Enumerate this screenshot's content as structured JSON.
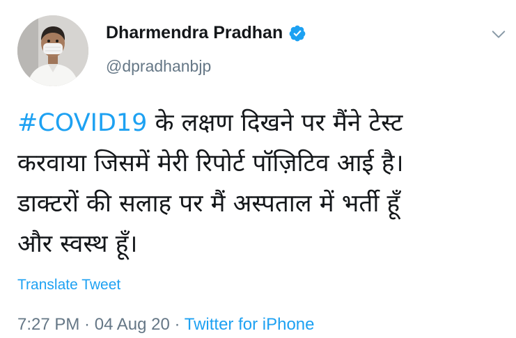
{
  "author": {
    "name": "Dharmendra Pradhan",
    "handle": "@dpradhanbjp",
    "verified": true,
    "avatar": "profile-photo-man-in-white-kurta-wearing-mask"
  },
  "tweet": {
    "hashtag": "#COVID19",
    "line1_rest": " के लक्षण दिखने पर मैंने टेस्ट",
    "line2": "करवाया जिसमें मेरी रिपोर्ट पॉज़िटिव आई है।",
    "line3": "डाक्टरों की सलाह पर मैं अस्पताल में भर्ती हूँ",
    "line4": "और स्वस्थ हूँ।"
  },
  "translate_label": "Translate Tweet",
  "meta": {
    "time": "7:27 PM",
    "separator1": " · ",
    "date": "04 Aug 20",
    "separator2": " · ",
    "source": "Twitter for iPhone"
  },
  "colors": {
    "accent": "#1da1f2",
    "text": "#14171a",
    "secondary": "#657786"
  },
  "icons": {
    "verified": "verified-badge-icon",
    "caret": "chevron-down-icon"
  }
}
